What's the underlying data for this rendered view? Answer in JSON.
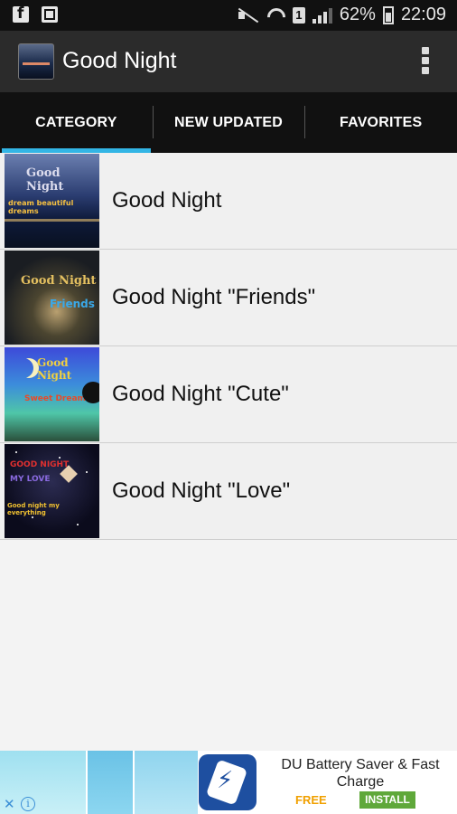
{
  "status_bar": {
    "battery": "62%",
    "time": "22:09",
    "sim_label": "1",
    "icons": [
      "facebook-icon",
      "image-icon",
      "mute-icon",
      "wifi-icon",
      "sim-icon",
      "signal-icon",
      "battery-icon"
    ]
  },
  "action_bar": {
    "title": "Good Night"
  },
  "tabs": [
    {
      "label": "CATEGORY",
      "active": true
    },
    {
      "label": "NEW UPDATED",
      "active": false
    },
    {
      "label": "FAVORITES",
      "active": false
    }
  ],
  "categories": [
    {
      "label": "Good Night",
      "thumb_text": [
        "Good Night",
        "dream beautiful dreams"
      ]
    },
    {
      "label": "Good Night \"Friends\"",
      "thumb_text": [
        "Good Night",
        "Friends"
      ]
    },
    {
      "label": "Good Night \"Cute\"",
      "thumb_text": [
        "Good Night",
        "Sweet Dreams"
      ]
    },
    {
      "label": "Good Night \"Love\"",
      "thumb_text": [
        "GOOD NIGHT",
        "MY LOVE",
        "Good night my everything"
      ]
    }
  ],
  "ad": {
    "title": "DU Battery Saver & Fast Charge",
    "price": "FREE",
    "install_label": "INSTALL",
    "close_symbol": "✕",
    "info_symbol": "i"
  },
  "colors": {
    "accent": "#33b5e5",
    "action_bar": "#2b2b2b",
    "tab_bar": "#111111",
    "install_green": "#5fa83a",
    "free_orange": "#f0a000"
  }
}
